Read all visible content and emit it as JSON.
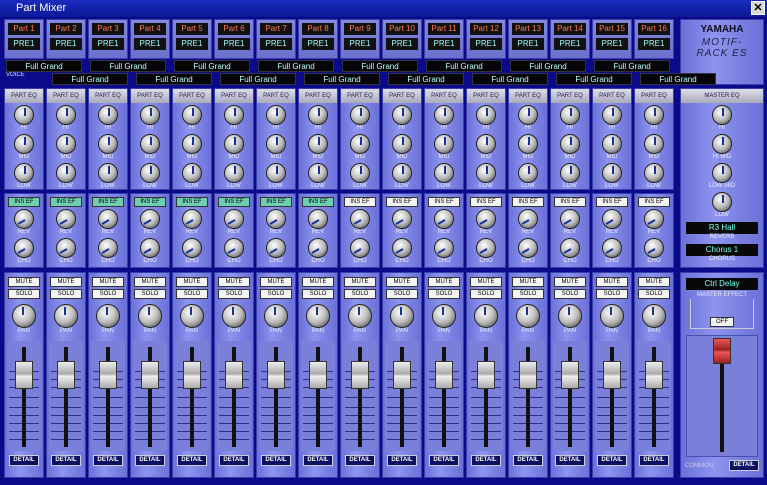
{
  "window": {
    "title": "Part Mixer",
    "close": "✕"
  },
  "labels": {
    "voice": "VOICE",
    "part_eq": "PART EQ",
    "hi": "HI",
    "mid": "MID",
    "low": "LOW",
    "ins_ef": "INS EF",
    "rev": "REV",
    "cho": "CHO",
    "mute": "MUTE",
    "solo": "SOLO",
    "pan": "PAN",
    "detail": "DETAIL"
  },
  "parts": [
    {
      "name": "Part 1",
      "bank": "PRE1",
      "voice": "Full Grand",
      "ins_ef_on": true
    },
    {
      "name": "Part 2",
      "bank": "PRE1",
      "voice": "Full Grand",
      "ins_ef_on": true
    },
    {
      "name": "Part 3",
      "bank": "PRE1",
      "voice": "Full Grand",
      "ins_ef_on": true
    },
    {
      "name": "Part 4",
      "bank": "PRE1",
      "voice": "Full Grand",
      "ins_ef_on": true
    },
    {
      "name": "Part 5",
      "bank": "PRE1",
      "voice": "Full Grand",
      "ins_ef_on": true
    },
    {
      "name": "Part 6",
      "bank": "PRE1",
      "voice": "Full Grand",
      "ins_ef_on": true
    },
    {
      "name": "Part 7",
      "bank": "PRE1",
      "voice": "Full Grand",
      "ins_ef_on": true
    },
    {
      "name": "Part 8",
      "bank": "PRE1",
      "voice": "Full Grand",
      "ins_ef_on": true
    },
    {
      "name": "Part 9",
      "bank": "PRE1",
      "voice": "Full Grand",
      "ins_ef_on": false
    },
    {
      "name": "Part 10",
      "bank": "PRE1",
      "voice": "Full Grand",
      "ins_ef_on": false
    },
    {
      "name": "Part 11",
      "bank": "PRE1",
      "voice": "Full Grand",
      "ins_ef_on": false
    },
    {
      "name": "Part 12",
      "bank": "PRE1",
      "voice": "Full Grand",
      "ins_ef_on": false
    },
    {
      "name": "Part 13",
      "bank": "PRE1",
      "voice": "Full Grand",
      "ins_ef_on": false
    },
    {
      "name": "Part 14",
      "bank": "PRE1",
      "voice": "Full Grand",
      "ins_ef_on": false
    },
    {
      "name": "Part 15",
      "bank": "PRE1",
      "voice": "Full Grand",
      "ins_ef_on": false
    },
    {
      "name": "Part 16",
      "bank": "PRE1",
      "voice": "Full Grand",
      "ins_ef_on": false
    }
  ],
  "brand": {
    "maker": "YAMAHA",
    "model": "MOTIF-RACK ES"
  },
  "master": {
    "eq_title": "MASTER EQ",
    "knobs": [
      "HI",
      "HI MID",
      "LOW MID",
      "LOW"
    ],
    "reverb_value": "R3 Hall",
    "reverb_label": "REVERB",
    "chorus_value": "Chorus 1",
    "chorus_label": "CHORUS",
    "effect_value": "Ctrl Delay",
    "effect_label": "MASTER EFFECT",
    "effect_button": "OFF",
    "common": "COMMON",
    "detail": "DETAIL"
  }
}
